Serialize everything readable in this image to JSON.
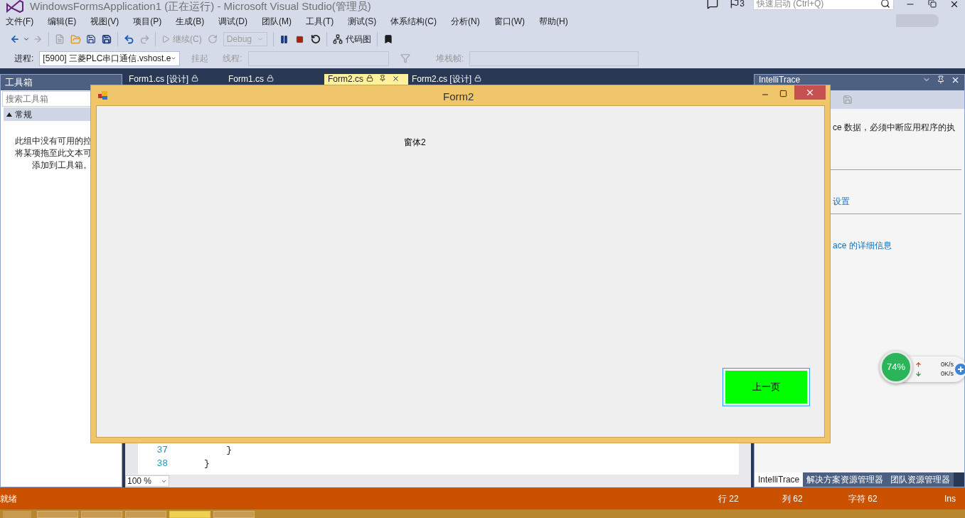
{
  "window": {
    "title": "WindowsFormsApplication1 (正在运行) - Microsoft Visual Studio(管理员)"
  },
  "title_bar": {
    "notification_count": "3",
    "quick_launch_placeholder": "快速启动 (Ctrl+Q)"
  },
  "menu": [
    "文件(F)",
    "编辑(E)",
    "视图(V)",
    "项目(P)",
    "生成(B)",
    "调试(D)",
    "团队(M)",
    "工具(T)",
    "测试(S)",
    "体系结构(C)",
    "分析(N)",
    "窗口(W)",
    "帮助(H)"
  ],
  "toolbar": {
    "continue": "继续(C)",
    "configuration": "Debug",
    "code_map": "代码图"
  },
  "debug_toolbar": {
    "process_label": "进程:",
    "process": "[5900] 三菱PLC串口通信.vshost.e",
    "suspend": "挂起",
    "thread_label": "线程:",
    "stack_label": "堆栈帧:"
  },
  "toolbox": {
    "title": "工具箱",
    "search_placeholder": "搜索工具箱",
    "group": {
      "label": "常规",
      "expanded": true
    },
    "message_lines": [
      "此组中没有可用的控",
      "将某项拖至此文本可",
      "添加到工具箱。"
    ]
  },
  "editor": {
    "tabs": [
      {
        "label": "Form1.cs [设计]",
        "selected": false
      },
      {
        "label": "Form1.cs",
        "selected": false
      },
      {
        "label": "Form2.cs",
        "selected": true
      },
      {
        "label": "Form2.cs [设计]",
        "selected": false
      }
    ],
    "lines": [
      {
        "number": "37",
        "code": "         }"
      },
      {
        "number": "38",
        "code": "     }"
      }
    ],
    "zoom": "100 %"
  },
  "intellitrace": {
    "title": "IntelliTrace",
    "items": [
      {
        "kind": "text",
        "text": "ce 数据，必须中断应用程序的执"
      },
      {
        "kind": "link",
        "text": "设置"
      },
      {
        "kind": "link",
        "text": "ace 的详细信息"
      }
    ],
    "bottom_tabs": [
      {
        "label": "IntelliTrace",
        "selected": true
      },
      {
        "label": "解决方案资源管理器",
        "selected": false
      },
      {
        "label": "团队资源管理器",
        "selected": false
      }
    ]
  },
  "form2": {
    "title": "Form2",
    "label": "窗体2",
    "button": "上一页"
  },
  "net_widget": {
    "percent": "74%",
    "upload": "0K/s",
    "download": "0K/s"
  },
  "status_bar": {
    "text": "就绪",
    "line": "行 22",
    "column": "列 62",
    "char": "字符 62",
    "mode": "Ins"
  }
}
